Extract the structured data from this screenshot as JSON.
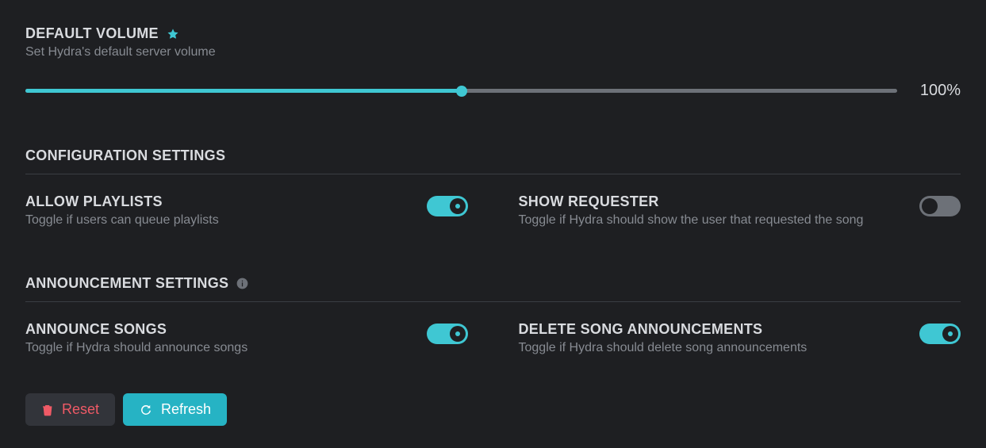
{
  "colors": {
    "accent": "#3fc7d3",
    "danger": "#ef5a66",
    "track": "#6d7178"
  },
  "volume": {
    "title": "DEFAULT VOLUME",
    "desc": "Set Hydra's default server volume",
    "value": 100,
    "max": 200,
    "display": "100%"
  },
  "config": {
    "title": "CONFIGURATION SETTINGS",
    "allow_playlists": {
      "title": "ALLOW PLAYLISTS",
      "desc": "Toggle if users can queue playlists",
      "enabled": true
    },
    "show_requester": {
      "title": "SHOW REQUESTER",
      "desc": "Toggle if Hydra should show the user that requested the song",
      "enabled": false
    }
  },
  "announcement": {
    "title": "ANNOUNCEMENT SETTINGS",
    "announce_songs": {
      "title": "ANNOUNCE SONGS",
      "desc": "Toggle if Hydra should announce songs",
      "enabled": true
    },
    "delete_announcements": {
      "title": "DELETE SONG ANNOUNCEMENTS",
      "desc": "Toggle if Hydra should delete song announcements",
      "enabled": true
    }
  },
  "footer": {
    "reset": "Reset",
    "refresh": "Refresh"
  }
}
